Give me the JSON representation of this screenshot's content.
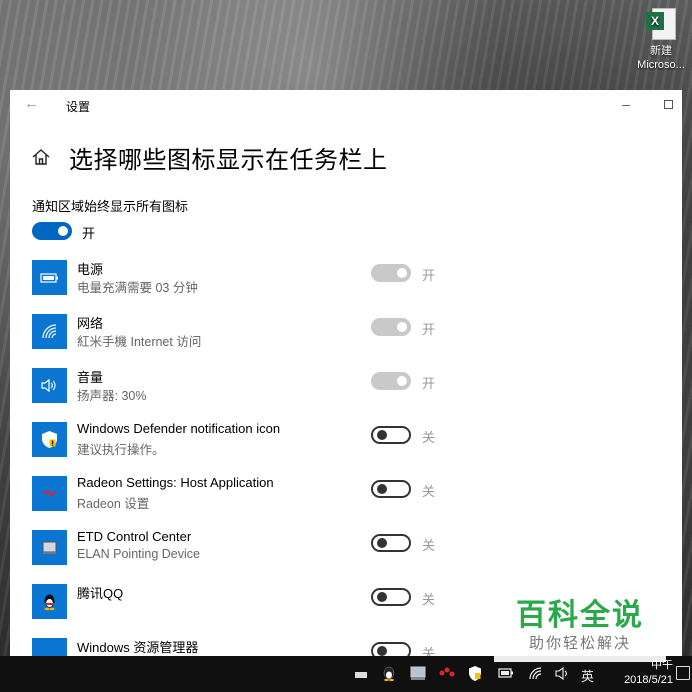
{
  "desktop": {
    "icon_label_1": "新建",
    "icon_label_2": "Microso..."
  },
  "window": {
    "title": "设置",
    "page_title": "选择哪些图标显示在任务栏上",
    "section_label": "通知区域始终显示所有图标",
    "master_toggle_state": "开",
    "rows": [
      {
        "name": "电源",
        "desc": "电量充满需要 03 分钟",
        "state": "开",
        "toggle": "on-disabled",
        "icon": "battery-icon"
      },
      {
        "name": "网络",
        "desc": "紅米手機 Internet 访问",
        "state": "开",
        "toggle": "on-disabled",
        "icon": "wifi-icon"
      },
      {
        "name": "音量",
        "desc": "扬声器: 30%",
        "state": "开",
        "toggle": "on-disabled",
        "icon": "speaker-icon"
      },
      {
        "name": "Windows Defender notification icon",
        "desc": "建议执行操作。",
        "state": "关",
        "toggle": "off",
        "icon": "defender-shield-icon"
      },
      {
        "name": "Radeon Settings: Host Application",
        "desc": "Radeon 设置",
        "state": "关",
        "toggle": "off",
        "icon": "radeon-icon"
      },
      {
        "name": "ETD Control Center",
        "desc": "ELAN Pointing Device",
        "state": "关",
        "toggle": "off",
        "icon": "touchpad-icon"
      },
      {
        "name": "腾讯QQ",
        "desc": "",
        "state": "关",
        "toggle": "off",
        "icon": "qq-penguin-icon"
      },
      {
        "name": "Windows 资源管理器",
        "desc": "",
        "state": "关",
        "toggle": "off",
        "icon": "usb-eject-icon"
      }
    ]
  },
  "taskbar": {
    "input_method": "英",
    "clock_time": "中午",
    "clock_date": "2018/5/21"
  },
  "watermark": {
    "title": "百科全说",
    "subtitle": "助你轻松解决"
  },
  "colors": {
    "accent": "#0067c0",
    "row_icon_bg": "#0a76d2",
    "watermark_green": "#2aa84a"
  }
}
